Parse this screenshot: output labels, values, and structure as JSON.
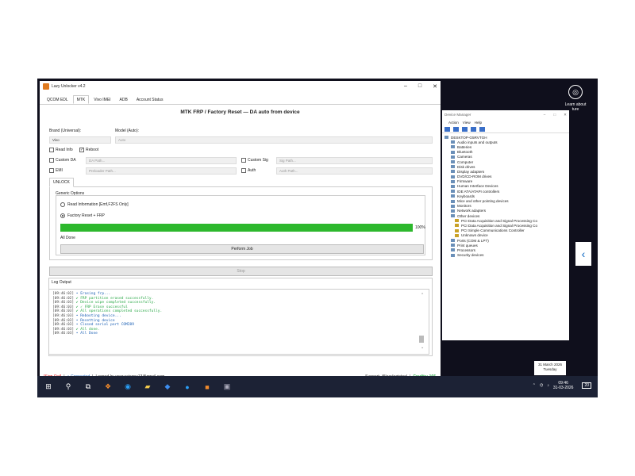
{
  "app": {
    "title": "Lazy Unlocker v4.2",
    "tabs": [
      "QCOM EDL",
      "MTK",
      "Vivo IMEI",
      "ADB",
      "Account Status"
    ],
    "heading": "MTK FRP / Factory Reset — DA auto from device",
    "brand_label": "Brand (Universal):",
    "model_label": "Model (Auto):",
    "brand_value": "Vivo",
    "model_value": "Auto",
    "read_info": "Read Info",
    "reboot": "Reboot",
    "custom_da": "Custom DA",
    "da_path": "DA Path...",
    "custom_sig": "Custom Sig",
    "sig_path": "Sig Path...",
    "emi": "EMI",
    "preloader_path": "Preloader Path...",
    "auth": "Auth",
    "auth_path": "Auth Path...",
    "subtab": "UNLOCK",
    "generic_options": "Generic Options",
    "opt_read": "Read Information [Emf,F2FS Only]",
    "opt_reset": "Factory Reset + FRP",
    "progress_pct": "100%",
    "progress_value": 1.0,
    "progress_color": "#2db82d",
    "status": "All Done",
    "perform": "Perform Job",
    "stop": "Stop",
    "log_title": "Log Output",
    "log_lines": [
      {
        "ts": "[09:46:02]",
        "text": " • Erasing frp...",
        "kind": "info"
      },
      {
        "ts": "[09:46:02]",
        "text": " ✔ FRP partition erased successfully.",
        "kind": "ok"
      },
      {
        "ts": "[09:46:03]",
        "text": " ✔ Device wipe completed successfully.",
        "kind": "ok"
      },
      {
        "ts": "[09:46:03]",
        "text": " ✔ ✓ FRP Erase successful",
        "kind": "ok"
      },
      {
        "ts": "[09:46:03]",
        "text": " ✔ All operations completed successfully.",
        "kind": "ok"
      },
      {
        "ts": "[09:46:03]",
        "text": " • Rebooting device...",
        "kind": "info"
      },
      {
        "ts": "[09:46:03]",
        "text": " • Resetting device",
        "kind": "info"
      },
      {
        "ts": "[09:46:03]",
        "text": " • Closed serial port COM289",
        "kind": "info"
      },
      {
        "ts": "[09:46:03]",
        "text": " ✔ All done.",
        "kind": "ok"
      },
      {
        "ts": "[09:46:03]",
        "text": " • All Done",
        "kind": "info"
      }
    ],
    "sign_out": "[Sign Out]",
    "connected": "● Connected",
    "logged_in": "Logged In: www.rajsonu13@gmail.com",
    "support": "Support: @lazylogintool",
    "credits": "Credits: 166"
  },
  "device_manager": {
    "title": "Device Manager",
    "menu": [
      "Action",
      "View",
      "Help"
    ],
    "root": "DESKTOP-G5RVTGH",
    "nodes": [
      "Audio inputs and outputs",
      "Batteries",
      "Bluetooth",
      "Cameras",
      "Computer",
      "Disk drives",
      "Display adapters",
      "DVD/CD-ROM drives",
      "Firmware",
      "Human Interface Devices",
      "IDE ATA/ATAPI controllers",
      "Keyboards",
      "Mice and other pointing devices",
      "Monitors",
      "Network adapters",
      "Other devices"
    ],
    "other_children": [
      "PCI Data Acquisition and Signal Processing Co",
      "PCI Data Acquisition and Signal Processing Co",
      "PCI Simple Communications Controller",
      "Unknown device"
    ],
    "tail_nodes": [
      "Ports (COM & LPT)",
      "Print queues",
      "Processors",
      "Security devices"
    ]
  },
  "desktop": {
    "learn_about": "Learn about",
    "picture": "ture"
  },
  "taskbar": {
    "time": "09:46",
    "date": "31-03-2026",
    "notif_date": "31 March 2026",
    "notif_day": "Tuesday",
    "badge": "20"
  }
}
